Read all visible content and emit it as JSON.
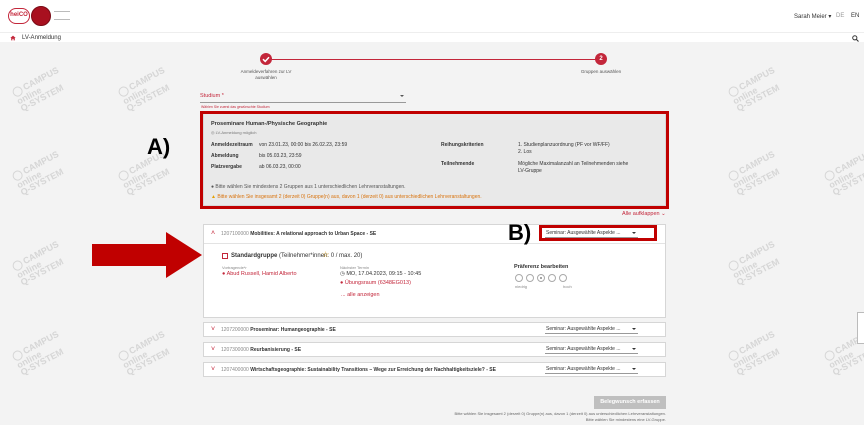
{
  "header": {
    "logo_text": "heiCO",
    "user_menu": "Sarah Meier ▾",
    "lang_de": "DE",
    "lang_en": "EN"
  },
  "nav": {
    "title": "LV-Anmeldung"
  },
  "watermark": {
    "line1": "CAMPUS",
    "line2": "online",
    "line3": "Q-SYSTEM"
  },
  "stepper": {
    "step1_label": "Anmeldeverfahren zur LV auswählen",
    "step1_icon": "check-icon",
    "step2_number": "2",
    "step2_label": "Gruppen auswählen"
  },
  "studium": {
    "label": "Studium *",
    "help": "Wählen Sie zuerst das gewünschte Studium"
  },
  "info": {
    "title": "Proseminare Human-/Physische Geographie",
    "subtitle": "LV-Anmeldung möglich",
    "rows": [
      {
        "label": "Anmeldezeitraum",
        "value": "von 23.01.23, 00:00 bis 26.02.23, 23:59"
      },
      {
        "label": "Abmeldung",
        "value": "bis 05.03.23, 23:59"
      },
      {
        "label": "Platzvergabe",
        "value": "ab 06.03.23, 00:00"
      }
    ],
    "reihung_label": "Reihungskriterien",
    "reihung_value1": "1. Studienplanzuordnung (PF vor WF/FF)",
    "reihung_value2": "2. Los",
    "teiln_label": "Teilnehmende",
    "teiln_value1": "Mögliche Maximalanzahl an Teilnehmenden siehe",
    "teiln_value2": "LV-Gruppe",
    "notice_info": "Bitte wählen Sie mindestens 2 Gruppen aus 1 unterschiedlichen Lehrveranstaltungen.",
    "notice_warn": "Bitte wählen Sie insgesamt 2 (derzeit 0) Gruppe(n) aus, davon 1 (derzeit 0) aus unterschiedlichen Lehrveranstaltungen."
  },
  "annotations": {
    "a": "A)",
    "b": "B)"
  },
  "alle_aufklappen": "Alle aufklappen",
  "courses": [
    {
      "num": "1207100000",
      "title": "Mobilities: A relational approach to Urban Space - SE",
      "select": "Seminar: Ausgewählte Aspekte ..."
    },
    {
      "num": "1207200000",
      "title": "Proseminar: Humangeographie - SE",
      "select": "Seminar: Ausgewählte Aspekte ..."
    },
    {
      "num": "1207300000",
      "title": "Reurbanisierung - SE",
      "select": "Seminar: Ausgewählte Aspekte ..."
    },
    {
      "num": "1207400000",
      "title": "Wirtschaftsgeographie: Sustainability Transitions – Wege zur Erreichung der Nachhaltigkeitsziele? - SE",
      "select": "Seminar: Ausgewählte Aspekte ..."
    }
  ],
  "group": {
    "name": "Standardgruppe",
    "capacity": "(Teilnehmer*innen: 0 / max. 20)",
    "lecturer_label": "Vortragende*r",
    "lecturer": "Abud Russell, Hamid Alberto",
    "next_label": "Nächster Termin",
    "next_date": "MO, 17.04.2023, 09:15 - 10:45",
    "room": "Übungsraum (6348EG013)",
    "show_all": "... alle anzeigen",
    "pref_title": "Präferenz bearbeiten",
    "pref_low": "niedrig",
    "pref_high": "hoch"
  },
  "footer": {
    "button": "Belegwunsch erfassen",
    "note1": "Bitte wählen Sie insgesamt 2 (derzeit 0) Gruppe(n) aus, davon 1 (derzeit 0) aus unterschiedlichen Lehrveranstaltungen.",
    "note2": "Bitte wählen Sie mindestens eine LV-Gruppe."
  },
  "colors": {
    "accent": "#c3263a",
    "annotation": "#c00000",
    "warn": "#d9730d"
  }
}
